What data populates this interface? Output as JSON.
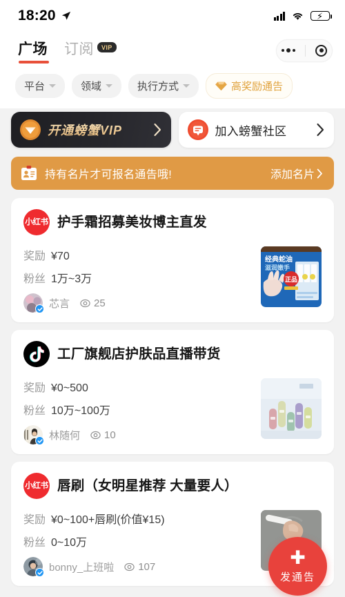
{
  "status_bar": {
    "time": "18:20",
    "location_icon": "location-arrow-icon",
    "signal_icon": "cellular-signal-icon",
    "wifi_icon": "wifi-icon",
    "battery_icon": "battery-charging-icon"
  },
  "nav": {
    "tabs": [
      {
        "label": "广场",
        "active": true
      },
      {
        "label": "订阅",
        "active": false,
        "badge": "VIP"
      }
    ],
    "capsule": {
      "menu_icon": "more-dots-icon",
      "close_icon": "target-circle-icon"
    }
  },
  "filters": [
    {
      "label": "平台",
      "type": "dropdown"
    },
    {
      "label": "领域",
      "type": "dropdown"
    },
    {
      "label": "执行方式",
      "type": "dropdown"
    },
    {
      "label": "高奖励通告",
      "type": "highlight",
      "icon": "diamond-icon",
      "color": "#e0a23c"
    }
  ],
  "banners": {
    "vip": {
      "label": "开通螃蟹VIP",
      "icon": "vip-shield-icon",
      "chevron": "chevron-right-icon"
    },
    "community": {
      "label": "加入螃蟹社区",
      "icon": "chat-bubble-icon",
      "chevron": "chevron-right-icon"
    }
  },
  "notice": {
    "icon": "id-card-icon",
    "text": "持有名片才可报名通告哦!",
    "action": "添加名片",
    "chevron": "chevron-right-icon",
    "background": "#e09a45"
  },
  "cards": [
    {
      "platform": "小红书",
      "platform_key": "xhs",
      "title": "护手霜招募美妆博主直发",
      "reward_label": "奖励",
      "reward_value": "¥70",
      "fans_label": "粉丝",
      "fans_value": "1万~3万",
      "author": "芯言",
      "verified": true,
      "views": "25",
      "thumb_alt": "经典蛇油滋润嫩手 护手霜产品图"
    },
    {
      "platform": "抖音",
      "platform_key": "douyin",
      "title": "工厂旗舰店护肤品直播带货",
      "reward_label": "奖励",
      "reward_value": "¥0~500",
      "fans_label": "粉丝",
      "fans_value": "10万~100万",
      "author": "林随何",
      "verified": true,
      "views": "10",
      "thumb_alt": "彩色护肤品瓶装系列产品图"
    },
    {
      "platform": "小红书",
      "platform_key": "xhs",
      "title": "唇刷（女明星推荐 大量要人）",
      "reward_label": "奖励",
      "reward_value": "¥0~100+唇刷(价值¥15)",
      "fans_label": "粉丝",
      "fans_value": "0~10万",
      "author": "bonny_上班啦",
      "verified": true,
      "views": "107",
      "thumb_alt": "手持唇刷产品图"
    }
  ],
  "fab": {
    "plus_icon": "plus-icon",
    "label": "发通告",
    "color": "#e8423c"
  }
}
